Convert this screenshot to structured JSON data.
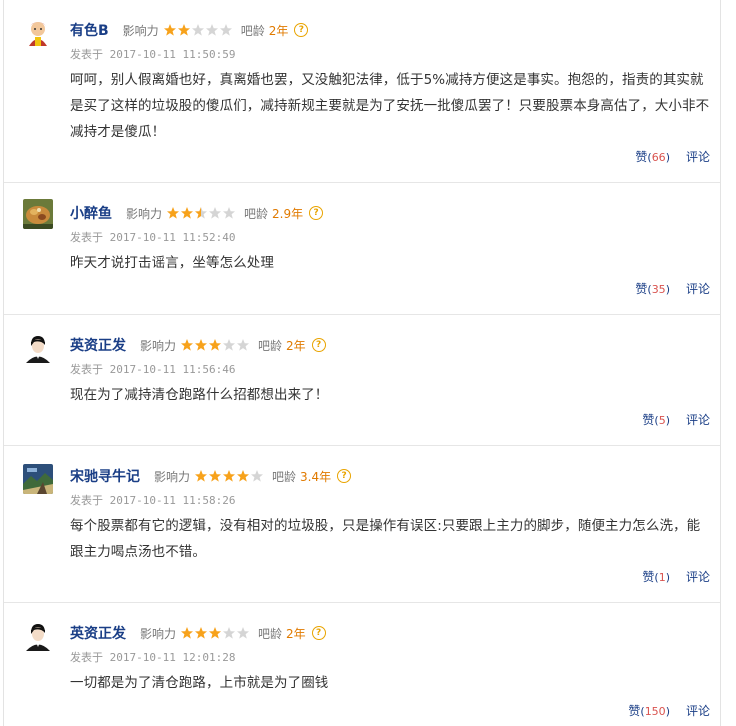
{
  "labels": {
    "influence": "影响力",
    "age": "吧龄",
    "posted_prefix": "发表于",
    "like": "赞",
    "reply": "评论"
  },
  "colors": {
    "username": "#1a3e86",
    "star_on": "#f7a21b",
    "star_off": "#d5d5d5",
    "age": "#e07a00",
    "like_count": "#d9534f"
  },
  "comments": [
    {
      "username": "有色B",
      "avatar": "cartoon-avatar",
      "rating": 2,
      "age": "2年",
      "posted": "发表于 2017-10-11 11:50:59",
      "content": "呵呵，别人假离婚也好，真离婚也罢，又没触犯法律，低于5%减持方便这是事实。抱怨的，指责的其实就是买了这样的垃圾股的傻瓜们，减持新规主要就是为了安抚一批傻瓜罢了！只要股票本身高估了，大小非不减持才是傻瓜！",
      "likes": "66"
    },
    {
      "username": "小醉鱼",
      "avatar": "food-avatar",
      "rating": 2.5,
      "age": "2.9年",
      "posted": "发表于 2017-10-11 11:52:40",
      "content": "昨天才说打击谣言，坐等怎么处理",
      "likes": "35"
    },
    {
      "username": "英资正发",
      "avatar": "person-avatar",
      "rating": 3,
      "age": "2年",
      "posted": "发表于 2017-10-11 11:56:46",
      "content": "现在为了减持清仓跑路什么招都想出来了！",
      "likes": "5"
    },
    {
      "username": "宋驰寻牛记",
      "avatar": "landscape-avatar",
      "rating": 4,
      "age": "3.4年",
      "posted": "发表于 2017-10-11 11:58:26",
      "content": "每个股票都有它的逻辑，没有相对的垃圾股，只是操作有误区:只要跟上主力的脚步，随便主力怎么洗，能跟主力喝点汤也不错。",
      "likes": "1"
    },
    {
      "username": "英资正发",
      "avatar": "person-avatar",
      "rating": 3,
      "age": "2年",
      "posted": "发表于 2017-10-11 12:01:28",
      "content": "一切都是为了清仓跑路，上市就是为了圈钱",
      "likes": "150"
    }
  ]
}
